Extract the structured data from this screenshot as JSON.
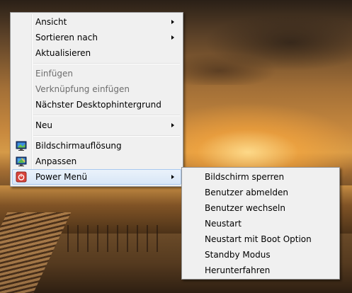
{
  "context_menu": {
    "items": [
      {
        "label": "Ansicht"
      },
      {
        "label": "Sortieren nach"
      },
      {
        "label": "Aktualisieren"
      },
      {
        "label": "Einfügen"
      },
      {
        "label": "Verknüpfung einfügen"
      },
      {
        "label": "Nächster Desktophintergrund"
      },
      {
        "label": "Neu"
      },
      {
        "label": "Bildschirmauflösung",
        "icon": "monitor-icon"
      },
      {
        "label": "Anpassen",
        "icon": "personalize-icon"
      },
      {
        "label": "Power Menü",
        "icon": "power-icon"
      }
    ]
  },
  "power_submenu": {
    "items": [
      {
        "label": "Bildschirm sperren"
      },
      {
        "label": "Benutzer abmelden"
      },
      {
        "label": "Benutzer wechseln"
      },
      {
        "label": "Neustart"
      },
      {
        "label": "Neustart mit Boot Option"
      },
      {
        "label": "Standby Modus"
      },
      {
        "label": "Herunterfahren"
      }
    ]
  },
  "colors": {
    "menu_bg": "#f0f0f0",
    "highlight": "#d8e6f6",
    "disabled_text": "#6d6d6d",
    "power_icon": "#d9453c"
  }
}
